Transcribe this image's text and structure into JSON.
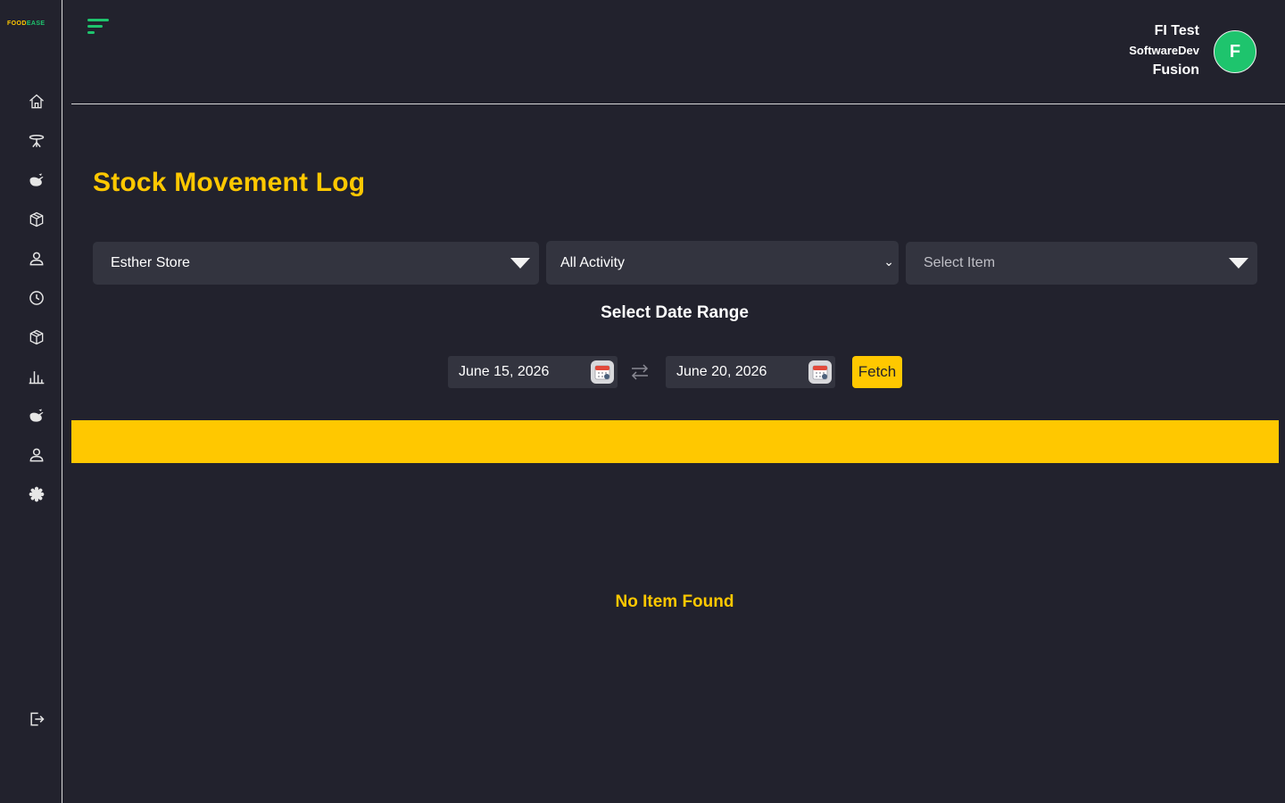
{
  "brand": {
    "part1": "FOOD",
    "part2": "EASE"
  },
  "user": {
    "line1": "FI Test",
    "line2": "SoftwareDev",
    "line3": "Fusion",
    "avatar_initial": "F"
  },
  "sidebar": {
    "items": [
      {
        "icon": "home-icon"
      },
      {
        "icon": "table-icon"
      },
      {
        "icon": "food-icon"
      },
      {
        "icon": "box-icon"
      },
      {
        "icon": "user-icon"
      },
      {
        "icon": "clock-icon"
      },
      {
        "icon": "inventory-box-icon"
      },
      {
        "icon": "bar-chart-icon"
      },
      {
        "icon": "food-icon"
      },
      {
        "icon": "staff-user-icon"
      },
      {
        "icon": "gear-icon"
      },
      {
        "icon": "logout-icon"
      }
    ]
  },
  "page": {
    "title": "Stock Movement Log"
  },
  "filters": {
    "store": {
      "value": "Esther Store"
    },
    "activity": {
      "value": "All Activity"
    },
    "item": {
      "placeholder": "Select Item"
    }
  },
  "date_range": {
    "label": "Select Date Range",
    "start": "June 15, 2026",
    "end": "June 20, 2026",
    "fetch_label": "Fetch"
  },
  "table": {
    "empty_message": "No Item Found"
  },
  "colors": {
    "accent": "#ffc800",
    "brand_green": "#1ec46d",
    "background": "#22222d",
    "input_bg": "#33343f"
  }
}
